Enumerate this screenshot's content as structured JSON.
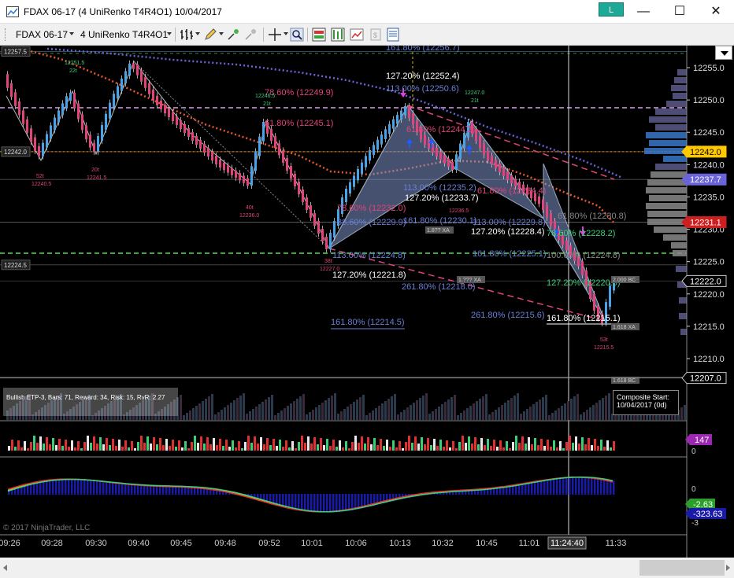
{
  "window": {
    "title": "FDAX 06-17 (4 UniRenko T4R4O1)  10/04/2017",
    "badge": "L",
    "minimize": "—",
    "maximize": "☐",
    "close": "✕"
  },
  "toolbar": {
    "instrument": "FDAX 06-17",
    "period": "4 UniRenko T4R4O1"
  },
  "colors": {
    "background": "#000000",
    "up_candle": "#4aa3e6",
    "down_candle": "#e0447a",
    "fib_blue": "#6a7fd6",
    "fib_pink": "#e0447a",
    "pattern_fill": "#7d93c9"
  },
  "price_axis": {
    "ticks": [
      "12255.0",
      "12250.0",
      "12245.0",
      "12240.0",
      "12235.0",
      "12230.0",
      "12225.0",
      "12220.0",
      "12215.0",
      "12210.0"
    ],
    "markers": [
      {
        "text": "12242.0",
        "color": "#ffc800",
        "fg": "#000"
      },
      {
        "text": "12237.7",
        "color": "#6a64d8",
        "fg": "#fff"
      },
      {
        "text": "12231.1",
        "color": "#cc1f1f",
        "fg": "#fff"
      },
      {
        "text": "12222.0",
        "color": "#000000",
        "fg": "#fff"
      },
      {
        "text": "12207.0",
        "color": "#000000",
        "fg": "#fff"
      }
    ],
    "left_labels": [
      "12257.5",
      "12242.0",
      "12224.5"
    ]
  },
  "time_axis": {
    "ticks": [
      "09:26",
      "09:28",
      "09:30",
      "09:40",
      "09:45",
      "09:48",
      "09:52",
      "10:01",
      "10:06",
      "10:13",
      "10:32",
      "10:45",
      "11:01",
      "11:24:40",
      "11:33"
    ]
  },
  "fib_labels": [
    "161.80% (12256.7)",
    "127.20% (12252.4)",
    "113.00% (12250.6)",
    "78.60% (12249.9)",
    "61.80% (12245.1)",
    "61.80% (12244.2)",
    "127.20% (12233.7)",
    "113.00% (12235.2)",
    "61.80% (12234.4)",
    "78.60% (12232.0)",
    "88.60% (12229.9)",
    "161.80% (12230.1)",
    "127.20% (12228.4)",
    "113.00% (12229.8)",
    "61.80% (12230.8)",
    "78.60% (12228.2)",
    "161.80% (12225.1)",
    "100.00% (12224.8)",
    "113.00% (12224.8)",
    "127.20% (12221.8)",
    "261.80% (12218.0)",
    "127.20% (12220.5)",
    "161.80% (12214.5)",
    "261.80% (12215.6)",
    "161.80% (12215.1)"
  ],
  "swing_labels": [
    "12251.5",
    "22t",
    "12246.5",
    "21t",
    "12247.0",
    "21t",
    "52t",
    "12240.5",
    "20t",
    "12241.5",
    "40t",
    "12236.0",
    "38t",
    "12227.0",
    "12236.5",
    "53t",
    "12215.5"
  ],
  "small_tags": [
    "1.8?? XA",
    "1.??? XA",
    "1.618 XA",
    "2.000 BC",
    "1.618 BC"
  ],
  "pattern_info": {
    "text": "Bullish ETP-3, Bars: 71, Reward: 34, Risk: 15, RvR: 2.27"
  },
  "composite": {
    "line1": "Composite Start:",
    "line2": "10/04/2017 (0d)"
  },
  "volume_panel": {
    "value_marker": "147",
    "ticks": [
      "100",
      "0"
    ]
  },
  "oscillator_panel": {
    "ticks": [
      "0",
      "-3"
    ],
    "marker1": "-2.63",
    "marker2": "-323.63"
  },
  "copyright": "© 2017 NinjaTrader, LLC"
}
